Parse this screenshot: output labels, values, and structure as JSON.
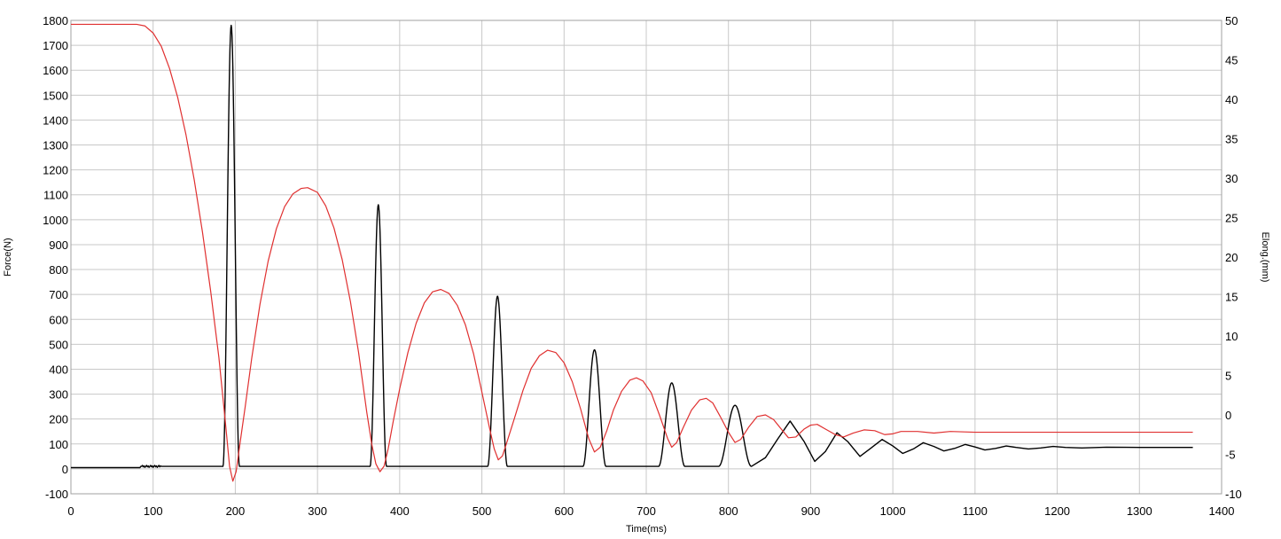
{
  "chart_data": {
    "type": "line",
    "xlabel": "Time(ms)",
    "ylabel_left": "Force(N)",
    "ylabel_right": "Elong.(mm)",
    "xlim": [
      0,
      1400
    ],
    "ylim_left": [
      -100,
      1800
    ],
    "ylim_right": [
      -10,
      50
    ],
    "x_ticks": [
      0,
      100,
      200,
      300,
      400,
      500,
      600,
      700,
      800,
      900,
      1000,
      1100,
      1200,
      1300,
      1400
    ],
    "y_left_ticks": [
      -100,
      0,
      100,
      200,
      300,
      400,
      500,
      600,
      700,
      800,
      900,
      1000,
      1100,
      1200,
      1300,
      1400,
      1500,
      1600,
      1700,
      1800
    ],
    "y_right_ticks": [
      -10,
      -5,
      0,
      5,
      10,
      15,
      20,
      25,
      30,
      35,
      40,
      45,
      50
    ],
    "grid": true,
    "colors": {
      "force": "#000000",
      "elong": "#e03030",
      "grid": "#c8c8c8"
    },
    "series": [
      {
        "axis": "left",
        "color": "#000000",
        "base_before": 5,
        "base_after": 10,
        "base_change_x": 85,
        "end_x": 1365,
        "pulses": [
          {
            "center": 195,
            "half_width": 10,
            "peak": 1780,
            "base": 10
          },
          {
            "center": 374,
            "half_width": 10,
            "peak": 1060,
            "base": 10
          },
          {
            "center": 519,
            "half_width": 12,
            "peak": 693,
            "base": 10
          },
          {
            "center": 637,
            "half_width": 14,
            "peak": 478,
            "base": 10
          },
          {
            "center": 731,
            "half_width": 16,
            "peak": 345,
            "base": 10
          },
          {
            "center": 808,
            "half_width": 20,
            "peak": 255,
            "base": 10
          }
        ],
        "ringdown": [
          [
            828,
            10
          ],
          [
            845,
            45
          ],
          [
            860,
            120
          ],
          [
            875,
            192
          ],
          [
            892,
            110
          ],
          [
            905,
            30
          ],
          [
            918,
            70
          ],
          [
            932,
            145
          ],
          [
            945,
            110
          ],
          [
            960,
            50
          ],
          [
            972,
            80
          ],
          [
            987,
            118
          ],
          [
            1000,
            92
          ],
          [
            1012,
            62
          ],
          [
            1025,
            80
          ],
          [
            1037,
            105
          ],
          [
            1050,
            90
          ],
          [
            1062,
            72
          ],
          [
            1075,
            82
          ],
          [
            1088,
            98
          ],
          [
            1100,
            88
          ],
          [
            1112,
            76
          ],
          [
            1125,
            82
          ],
          [
            1138,
            92
          ],
          [
            1150,
            86
          ],
          [
            1165,
            80
          ],
          [
            1180,
            84
          ],
          [
            1195,
            90
          ],
          [
            1210,
            86
          ],
          [
            1230,
            84
          ],
          [
            1260,
            87
          ],
          [
            1300,
            86
          ],
          [
            1330,
            86
          ],
          [
            1365,
            86
          ]
        ]
      },
      {
        "axis": "right",
        "color": "#e03030",
        "points": [
          [
            0,
            49.5
          ],
          [
            80,
            49.5
          ],
          [
            90,
            49.3
          ],
          [
            100,
            48.4
          ],
          [
            110,
            46.7
          ],
          [
            120,
            43.9
          ],
          [
            130,
            40.2
          ],
          [
            140,
            35.5
          ],
          [
            150,
            29.8
          ],
          [
            160,
            23.2
          ],
          [
            170,
            15.7
          ],
          [
            180,
            7.3
          ],
          [
            188,
            -1.0
          ],
          [
            193,
            -6.5
          ],
          [
            197,
            -8.4
          ],
          [
            201,
            -7.2
          ],
          [
            206,
            -3.4
          ],
          [
            212,
            1.0
          ],
          [
            220,
            7.2
          ],
          [
            230,
            14.0
          ],
          [
            240,
            19.5
          ],
          [
            250,
            23.6
          ],
          [
            260,
            26.4
          ],
          [
            270,
            28.0
          ],
          [
            280,
            28.7
          ],
          [
            288,
            28.8
          ],
          [
            300,
            28.2
          ],
          [
            310,
            26.5
          ],
          [
            320,
            23.7
          ],
          [
            330,
            19.7
          ],
          [
            340,
            14.4
          ],
          [
            350,
            7.9
          ],
          [
            360,
            0.3
          ],
          [
            366,
            -3.7
          ],
          [
            371,
            -6.2
          ],
          [
            376,
            -7.2
          ],
          [
            381,
            -6.5
          ],
          [
            386,
            -4.3
          ],
          [
            392,
            -0.9
          ],
          [
            400,
            3.3
          ],
          [
            410,
            7.9
          ],
          [
            420,
            11.6
          ],
          [
            430,
            14.2
          ],
          [
            440,
            15.6
          ],
          [
            450,
            15.9
          ],
          [
            460,
            15.4
          ],
          [
            470,
            13.9
          ],
          [
            480,
            11.4
          ],
          [
            490,
            7.7
          ],
          [
            500,
            2.9
          ],
          [
            510,
            -2.0
          ],
          [
            515,
            -4.3
          ],
          [
            520,
            -5.7
          ],
          [
            525,
            -5.2
          ],
          [
            530,
            -3.6
          ],
          [
            540,
            -0.3
          ],
          [
            550,
            3.1
          ],
          [
            560,
            5.9
          ],
          [
            570,
            7.5
          ],
          [
            580,
            8.2
          ],
          [
            590,
            7.9
          ],
          [
            600,
            6.6
          ],
          [
            610,
            4.2
          ],
          [
            620,
            0.8
          ],
          [
            630,
            -3.0
          ],
          [
            637,
            -4.7
          ],
          [
            644,
            -4.1
          ],
          [
            652,
            -2.0
          ],
          [
            660,
            0.6
          ],
          [
            670,
            3.0
          ],
          [
            680,
            4.4
          ],
          [
            688,
            4.7
          ],
          [
            696,
            4.3
          ],
          [
            706,
            2.8
          ],
          [
            716,
            0.0
          ],
          [
            726,
            -3.0
          ],
          [
            731,
            -4.1
          ],
          [
            737,
            -3.5
          ],
          [
            745,
            -1.6
          ],
          [
            755,
            0.6
          ],
          [
            765,
            1.9
          ],
          [
            773,
            2.1
          ],
          [
            781,
            1.5
          ],
          [
            790,
            -0.2
          ],
          [
            800,
            -2.2
          ],
          [
            808,
            -3.5
          ],
          [
            815,
            -3.1
          ],
          [
            825,
            -1.5
          ],
          [
            835,
            -0.2
          ],
          [
            845,
            0.0
          ],
          [
            855,
            -0.6
          ],
          [
            865,
            -1.9
          ],
          [
            873,
            -2.9
          ],
          [
            882,
            -2.8
          ],
          [
            892,
            -1.8
          ],
          [
            900,
            -1.3
          ],
          [
            908,
            -1.2
          ],
          [
            918,
            -1.8
          ],
          [
            930,
            -2.5
          ],
          [
            940,
            -2.8
          ],
          [
            952,
            -2.3
          ],
          [
            965,
            -1.9
          ],
          [
            978,
            -2.0
          ],
          [
            990,
            -2.5
          ],
          [
            1000,
            -2.4
          ],
          [
            1010,
            -2.1
          ],
          [
            1030,
            -2.1
          ],
          [
            1050,
            -2.3
          ],
          [
            1070,
            -2.1
          ],
          [
            1100,
            -2.2
          ],
          [
            1200,
            -2.2
          ],
          [
            1300,
            -2.2
          ],
          [
            1365,
            -2.2
          ]
        ]
      }
    ]
  }
}
